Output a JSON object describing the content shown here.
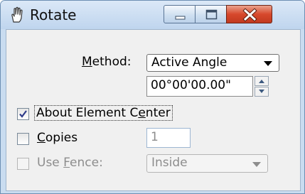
{
  "window": {
    "title": "Rotate",
    "icon": "rotate-hand-icon"
  },
  "caption_buttons": {
    "minimize": "minimize-icon",
    "maximize": "maximize-icon",
    "close": "close-icon"
  },
  "form": {
    "method": {
      "label_hot": "M",
      "label_rest": "ethod:",
      "value": "Active Angle"
    },
    "angle": {
      "value": "00°00'00.00\""
    },
    "about_center": {
      "label_pre": "About Element C",
      "label_hot": "e",
      "label_post": "nter",
      "checked": true
    },
    "copies": {
      "label_hot": "C",
      "label_rest": "opies",
      "value": "1",
      "checked": false
    },
    "use_fence": {
      "label_pre": "Use ",
      "label_hot": "F",
      "label_post": "ence:",
      "mode": "Inside",
      "checked": false,
      "enabled": false
    }
  }
}
